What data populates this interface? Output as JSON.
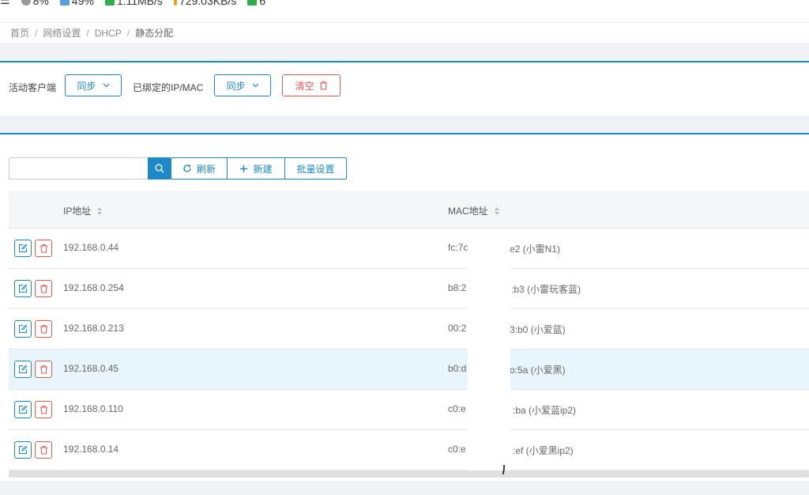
{
  "statusbar": {
    "menu_glyph": "☰",
    "cpu": "8%",
    "mem": "49%",
    "down": "1.11MB/s",
    "up": "729.03KB/s",
    "users": "6"
  },
  "breadcrumb": [
    "首页",
    "网络设置",
    "DHCP",
    "静态分配"
  ],
  "filters": {
    "active_clients_label": "活动客户端",
    "active_clients_btn": "同步",
    "bound_label": "已绑定的IP/MAC",
    "bound_btn": "同步",
    "clear_btn": "清空"
  },
  "toolbar": {
    "search_placeholder": "",
    "refresh": "刷新",
    "new": "新建",
    "batch": "批量设置"
  },
  "table": {
    "headers": {
      "ip": "IP地址",
      "mac": "MAC地址"
    },
    "rows": [
      {
        "ip": "192.168.0.44",
        "mac_start": "fc:7c",
        "mac_end": "e2 (小雷N1)"
      },
      {
        "ip": "192.168.0.254",
        "mac_start": "b8:2",
        "mac_end": ":b3 (小雷玩客蓝)"
      },
      {
        "ip": "192.168.0.213",
        "mac_start": "00:2",
        "mac_end": "3:b0 (小爱蓝)"
      },
      {
        "ip": "192.168.0.45",
        "mac_start": "b0:d",
        "mac_end": "o:5a (小爱黑)"
      },
      {
        "ip": "192.168.0.110",
        "mac_start": "c0:e",
        "mac_end": ":ba (小爱蓝ip2)"
      },
      {
        "ip": "192.168.0.14",
        "mac_start": "c0:e",
        "mac_end": ":ef (小爱黑ip2)"
      }
    ]
  },
  "colors": {
    "primary": "#1e88c8",
    "danger": "#e05a5a",
    "highlight_row": "#e8f5fc"
  }
}
